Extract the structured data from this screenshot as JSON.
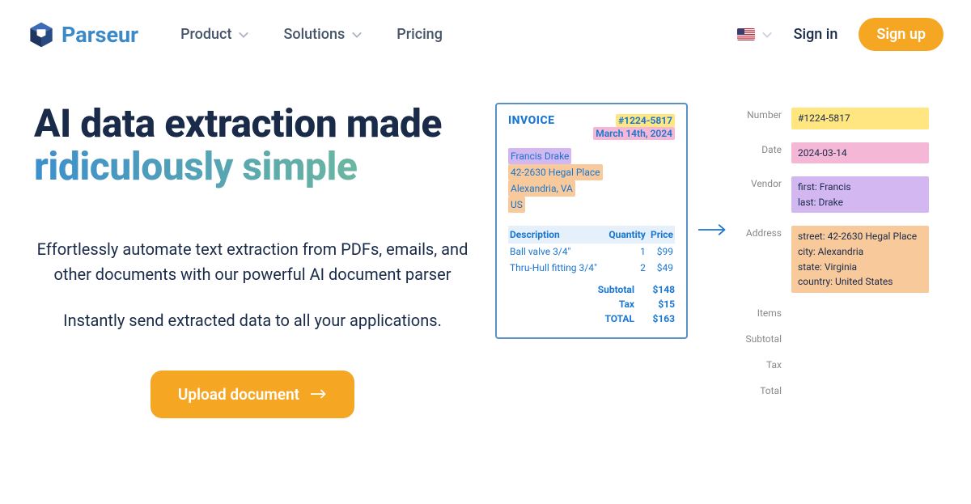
{
  "brand": "Parseur",
  "nav": {
    "product": "Product",
    "solutions": "Solutions",
    "pricing": "Pricing"
  },
  "auth": {
    "sign_in": "Sign in",
    "sign_up": "Sign up"
  },
  "hero": {
    "line1": "AI data extraction made",
    "line2": "ridiculously simple",
    "para1": "Effortlessly automate text extraction from PDFs, emails, and other documents with our powerful AI document parser",
    "para2": "Instantly send extracted data to all your applications.",
    "upload_label": "Upload document"
  },
  "doc": {
    "title": "INVOICE",
    "number": "#1224-5817",
    "date": "March 14th, 2024",
    "addr": {
      "name": "Francis Drake",
      "street": "42-2630 Hegal Place",
      "city": "Alexandria, VA",
      "country": "US"
    },
    "table": {
      "h_desc": "Description",
      "h_qty": "Quantity",
      "h_price": "Price",
      "rows": [
        {
          "desc": "Ball valve 3/4\"",
          "qty": "1",
          "price": "$99"
        },
        {
          "desc": "Thru-Hull fitting 3/4\"",
          "qty": "2",
          "price": "$49"
        }
      ]
    },
    "totals": {
      "subtotal_l": "Subtotal",
      "subtotal_v": "$148",
      "tax_l": "Tax",
      "tax_v": "$15",
      "total_l": "TOTAL",
      "total_v": "$163"
    }
  },
  "ext": {
    "number_l": "Number",
    "number_v": "#1224-5817",
    "date_l": "Date",
    "date_v": "2024-03-14",
    "vendor_l": "Vendor",
    "vendor_first": "first: Francis",
    "vendor_last": "last: Drake",
    "address_l": "Address",
    "addr_street": "street: 42-2630 Hegal Place",
    "addr_city": "city: Alexandria",
    "addr_state": "state: Virginia",
    "addr_country": "country: United States",
    "items_l": "Items",
    "subtotal_l": "Subtotal",
    "tax_l": "Tax",
    "total_l": "Total"
  }
}
